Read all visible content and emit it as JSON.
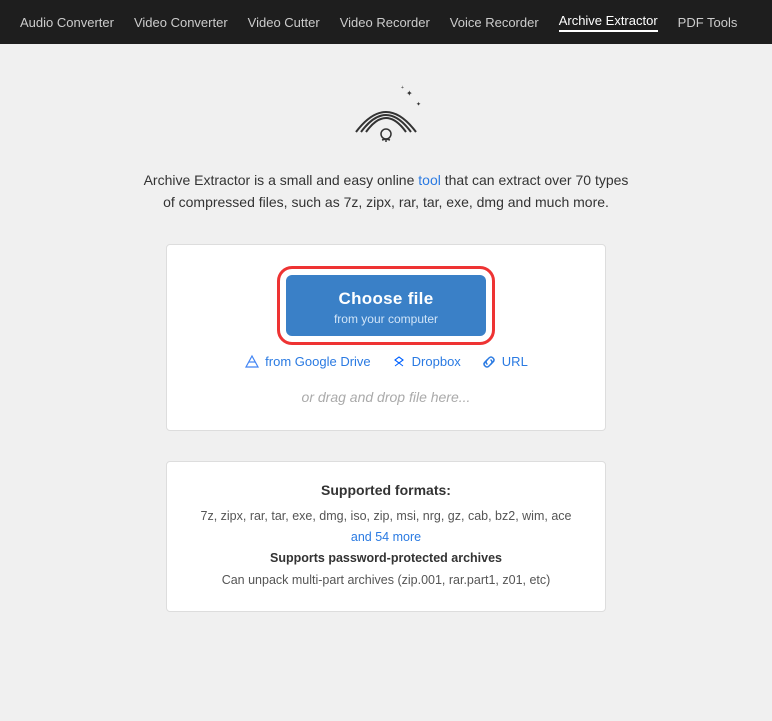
{
  "nav": {
    "items": [
      {
        "label": "Audio Converter",
        "active": false
      },
      {
        "label": "Video Converter",
        "active": false
      },
      {
        "label": "Video Cutter",
        "active": false
      },
      {
        "label": "Video Recorder",
        "active": false
      },
      {
        "label": "Voice Recorder",
        "active": false
      },
      {
        "label": "Archive Extractor",
        "active": true
      },
      {
        "label": "PDF Tools",
        "active": false
      }
    ]
  },
  "description": {
    "text_before": "Archive Extractor is a small and easy online ",
    "link_text": "tool",
    "text_after": " that can extract over 70 types of compressed files, such as 7z, zipx, rar, tar, exe, dmg and much more."
  },
  "upload": {
    "choose_btn_title": "Choose file",
    "choose_btn_sub": "from your computer",
    "source_google": "from Google Drive",
    "source_dropbox": "Dropbox",
    "source_url": "URL",
    "drag_drop": "or drag and drop file here..."
  },
  "formats": {
    "title": "Supported formats:",
    "list": "7z, zipx, rar, tar, exe, dmg, iso, zip, msi, nrg, gz, cab, bz2, wim, ace",
    "more_link": "and 54 more",
    "password_line": "Supports password-protected archives",
    "multipart_line": "Can unpack multi-part archives (zip.001, rar.part1, z01, etc)"
  }
}
